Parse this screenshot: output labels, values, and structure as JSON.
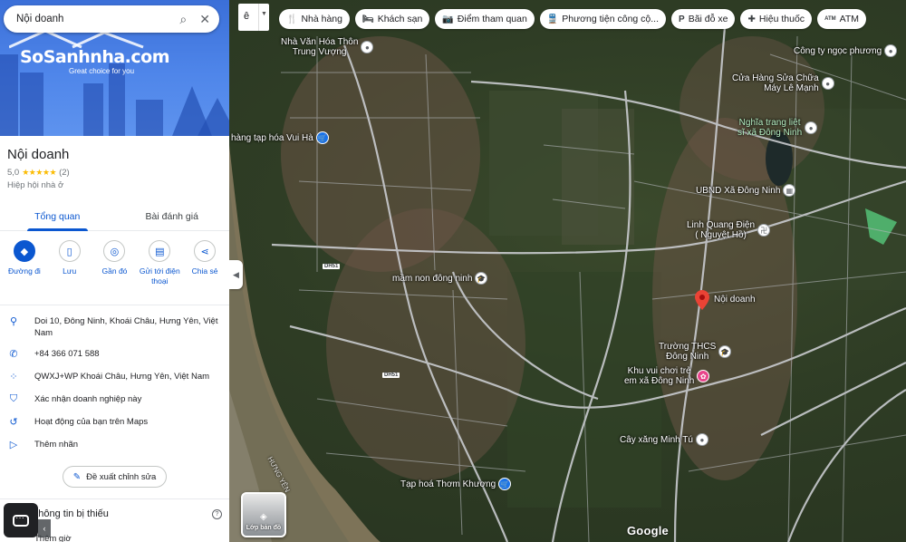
{
  "search": {
    "value": "Nội doanh"
  },
  "hero": {
    "logo": "SoSanhnha.com",
    "tagline": "Great choice for you"
  },
  "place": {
    "title": "Nội doanh",
    "rating": "5,0",
    "stars": "★★★★★",
    "review_count": "(2)",
    "category": "Hiệp hội nhà ở"
  },
  "tabs": [
    {
      "label": "Tổng quan",
      "active": true
    },
    {
      "label": "Bài đánh giá",
      "active": false
    }
  ],
  "actions": [
    {
      "label": "Đường đi",
      "icon": "directions-icon"
    },
    {
      "label": "Lưu",
      "icon": "bookmark-icon"
    },
    {
      "label": "Gần đó",
      "icon": "nearby-icon"
    },
    {
      "label": "Gửi tới điện thoại",
      "icon": "send-to-phone-icon"
    },
    {
      "label": "Chia sẻ",
      "icon": "share-icon"
    }
  ],
  "info": {
    "address": "Doi 10, Đông Ninh, Khoái Châu, Hưng Yên, Việt Nam",
    "phone": "+84 366 071 588",
    "plus_code": "QWXJ+WP Khoái Châu, Hưng Yên, Việt Nam",
    "verify": "Xác nhận doanh nghiệp này",
    "activity": "Hoạt động của bạn trên Maps",
    "label": "Thêm nhãn"
  },
  "suggest_edit": "Đề xuất chỉnh sửa",
  "more_info": {
    "title": "Thêm thông tin bị thiếu",
    "hours": "Thêm giờ"
  },
  "lang_button": "ê",
  "chips": [
    {
      "label": "Nhà hàng",
      "icon": "restaurant-icon"
    },
    {
      "label": "Khách sạn",
      "icon": "hotel-icon"
    },
    {
      "label": "Điểm tham quan",
      "icon": "camera-icon"
    },
    {
      "label": "Phương tiện công cộ...",
      "icon": "transit-icon"
    },
    {
      "label": "Bãi đỗ xe",
      "icon": "parking-icon"
    },
    {
      "label": "Hiệu thuốc",
      "icon": "pharmacy-icon"
    },
    {
      "label": "ATM",
      "icon": "atm-icon"
    }
  ],
  "layers_label": "Lớp bản đồ",
  "map_brand": "Google",
  "map_labels": {
    "nha_van_hoa_1": "Nhà Văn Hóa Thôn",
    "nha_van_hoa_2": "Trung Vượng",
    "cong_ty": "Công ty ngọc phương",
    "cua_hang_1": "Cửa Hàng Sửa Chữa",
    "cua_hang_2": "Máy Lê Mạnh",
    "tap_hoa_vui_ha": "hàng tạp hóa Vui Hà",
    "nghia_trang_1": "Nghĩa trang liệt",
    "nghia_trang_2": "sĩ xã Đông Ninh",
    "ubnd": "UBND Xã Đông Ninh",
    "linh_quang_1": "Linh Quang Điện",
    "linh_quang_2": "( Nguyệt Hồ)",
    "mam_non": "mầm non đông ninh",
    "noi_doanh": "Nội doanh",
    "truong_thcs_1": "Trường THCS",
    "truong_thcs_2": "Đông Ninh",
    "khu_vui_choi_1": "Khu vui chơi trẻ",
    "khu_vui_choi_2": "em xã Đông Ninh",
    "cay_xang": "Cây xăng Minh Tú",
    "tap_hoa_thom": "Tạp hoá Thơm Khương",
    "road_dh51_a": "DH51",
    "road_dh51_b": "DH51",
    "river": "HƯNG YÊN"
  },
  "colors": {
    "accent": "#0b57d0",
    "pin_red": "#ea4335",
    "star": "#fbbc04"
  }
}
